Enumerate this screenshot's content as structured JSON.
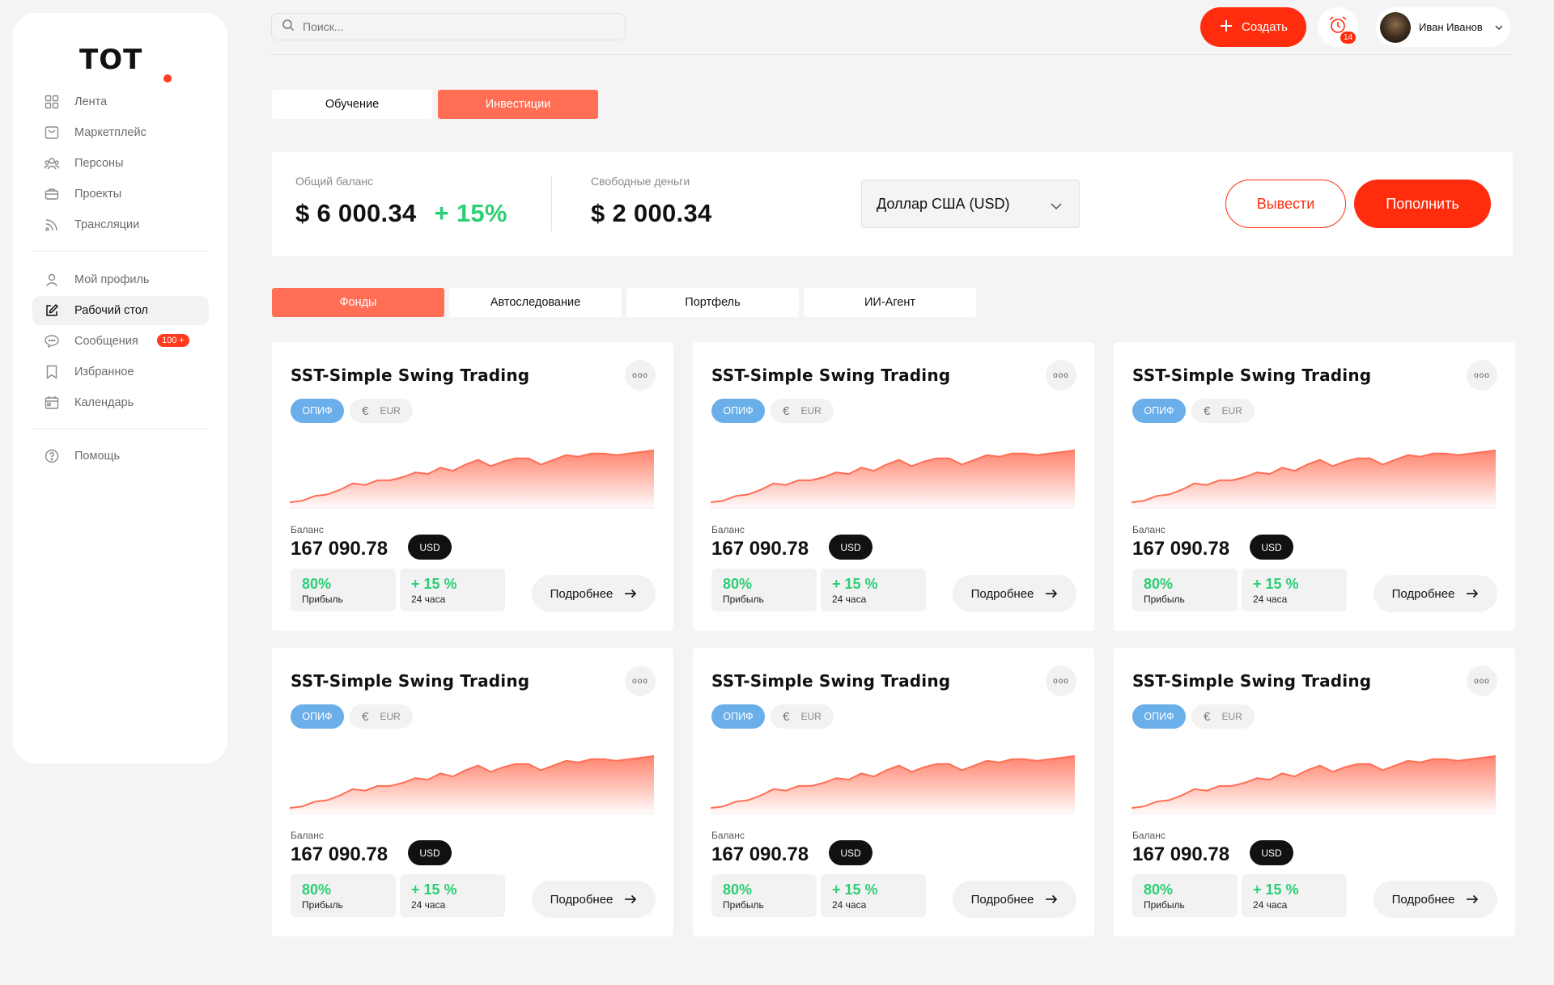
{
  "app": {
    "logo": "ТОТ"
  },
  "sidebar": {
    "primary": [
      {
        "label": "Лента",
        "icon": "grid-icon"
      },
      {
        "label": "Маркетплейс",
        "icon": "store-icon"
      },
      {
        "label": "Персоны",
        "icon": "people-icon"
      },
      {
        "label": "Проекты",
        "icon": "briefcase-icon"
      },
      {
        "label": "Трансляции",
        "icon": "broadcast-icon"
      }
    ],
    "secondary": [
      {
        "label": "Мой профиль",
        "icon": "user-icon"
      },
      {
        "label": "Рабочий стол",
        "icon": "desk-icon",
        "active": true
      },
      {
        "label": "Сообщения",
        "icon": "chat-icon",
        "badge": "100 +"
      },
      {
        "label": "Избранное",
        "icon": "bookmark-icon"
      },
      {
        "label": "Календарь",
        "icon": "calendar-icon"
      }
    ],
    "tertiary": [
      {
        "label": "Помощь",
        "icon": "help-icon"
      }
    ]
  },
  "topbar": {
    "search_placeholder": "Поиск...",
    "create_label": "Создать",
    "notifications_count": "14",
    "user_name": "Иван Иванов"
  },
  "tabs_top": [
    {
      "label": "Обучение",
      "active": false
    },
    {
      "label": "Инвестиции",
      "active": true
    }
  ],
  "balance": {
    "total_label": "Общий баланс",
    "total_value": "$ 6 000.34",
    "total_change": "+ 15%",
    "free_label": "Свободные деньги",
    "free_value": "$ 2 000.34",
    "currency": "Доллар США (USD)",
    "withdraw_label": "Вывести",
    "deposit_label": "Пополнить"
  },
  "tabs_sub": [
    {
      "label": "Фонды",
      "active": true
    },
    {
      "label": "Автоследование",
      "active": false
    },
    {
      "label": "Портфель",
      "active": false
    },
    {
      "label": "ИИ-Агент",
      "active": false
    }
  ],
  "colors": {
    "accent": "#ff2d0e",
    "tab_active": "#ff6e55",
    "positive": "#2bcf74",
    "badge_blue": "#6aaeea"
  },
  "chart_series": [
    10,
    11,
    14,
    15,
    18,
    22,
    21,
    24,
    24,
    26,
    29,
    28,
    32,
    30,
    34,
    37,
    33,
    36,
    38,
    38,
    34,
    37,
    40,
    39,
    41,
    41,
    40,
    41,
    42,
    43
  ],
  "funds": [
    {
      "title": "SST-Simple Swing Trading",
      "type": "ОПИФ",
      "currency_tag": "EUR",
      "balance_label": "Баланс",
      "balance": "167 090.78",
      "balance_currency": "USD",
      "profit": "80%",
      "profit_label": "Прибыль",
      "change": "+ 15 %",
      "change_label": "24 часа",
      "more_label": "Подробнее"
    },
    {
      "title": "SST-Simple Swing Trading",
      "type": "ОПИФ",
      "currency_tag": "EUR",
      "balance_label": "Баланс",
      "balance": "167 090.78",
      "balance_currency": "USD",
      "profit": "80%",
      "profit_label": "Прибыль",
      "change": "+ 15 %",
      "change_label": "24 часа",
      "more_label": "Подробнее"
    },
    {
      "title": "SST-Simple Swing Trading",
      "type": "ОПИФ",
      "currency_tag": "EUR",
      "balance_label": "Баланс",
      "balance": "167 090.78",
      "balance_currency": "USD",
      "profit": "80%",
      "profit_label": "Прибыль",
      "change": "+ 15 %",
      "change_label": "24 часа",
      "more_label": "Подробнее"
    },
    {
      "title": "SST-Simple Swing Trading",
      "type": "ОПИФ",
      "currency_tag": "EUR",
      "balance_label": "Баланс",
      "balance": "167 090.78",
      "balance_currency": "USD",
      "profit": "80%",
      "profit_label": "Прибыль",
      "change": "+ 15 %",
      "change_label": "24 часа",
      "more_label": "Подробнее"
    },
    {
      "title": "SST-Simple Swing Trading",
      "type": "ОПИФ",
      "currency_tag": "EUR",
      "balance_label": "Баланс",
      "balance": "167 090.78",
      "balance_currency": "USD",
      "profit": "80%",
      "profit_label": "Прибыль",
      "change": "+ 15 %",
      "change_label": "24 часа",
      "more_label": "Подробнее"
    },
    {
      "title": "SST-Simple Swing Trading",
      "type": "ОПИФ",
      "currency_tag": "EUR",
      "balance_label": "Баланс",
      "balance": "167 090.78",
      "balance_currency": "USD",
      "profit": "80%",
      "profit_label": "Прибыль",
      "change": "+ 15 %",
      "change_label": "24 часа",
      "more_label": "Подробнее"
    }
  ]
}
